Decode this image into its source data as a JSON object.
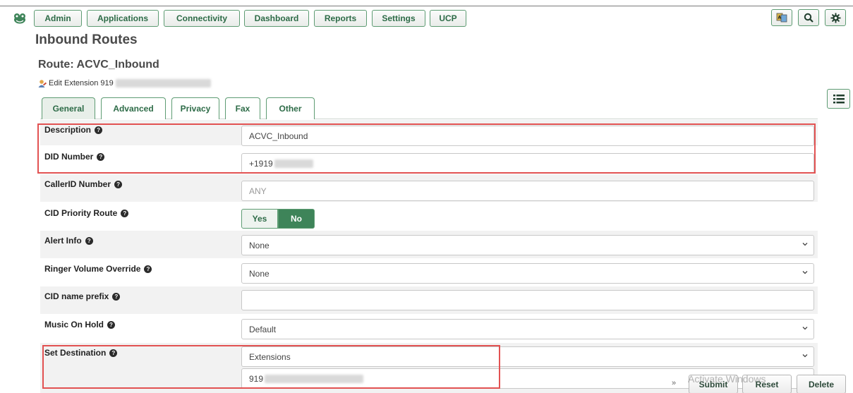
{
  "nav": {
    "items": [
      "Admin",
      "Applications",
      "Connectivity",
      "Dashboard",
      "Reports",
      "Settings",
      "UCP"
    ]
  },
  "page": {
    "title": "Inbound Routes",
    "route_title": "Route: ACVC_Inbound",
    "edit_link": "Edit Extension 919"
  },
  "tabs": [
    "General",
    "Advanced",
    "Privacy",
    "Fax",
    "Other"
  ],
  "form": {
    "description": {
      "label": "Description",
      "value": "ACVC_Inbound"
    },
    "did_number": {
      "label": "DID Number",
      "value": "+1919"
    },
    "callerid_number": {
      "label": "CallerID Number",
      "placeholder": "ANY"
    },
    "cid_priority": {
      "label": "CID Priority Route",
      "yes": "Yes",
      "no": "No",
      "selected": "No"
    },
    "alert_info": {
      "label": "Alert Info",
      "value": "None"
    },
    "ringer_volume": {
      "label": "Ringer Volume Override",
      "value": "None"
    },
    "cid_name_prefix": {
      "label": "CID name prefix",
      "value": ""
    },
    "music_on_hold": {
      "label": "Music On Hold",
      "value": "Default"
    },
    "set_destination": {
      "label": "Set Destination",
      "type_value": "Extensions",
      "target_value": "919"
    }
  },
  "actions": {
    "collapse": "»",
    "submit": "Submit",
    "reset": "Reset",
    "delete": "Delete"
  },
  "watermark": "Activate Windows",
  "colors": {
    "accent_green": "#3e8459",
    "nav_text": "#2d6b47",
    "highlight_red": "#e25252"
  }
}
